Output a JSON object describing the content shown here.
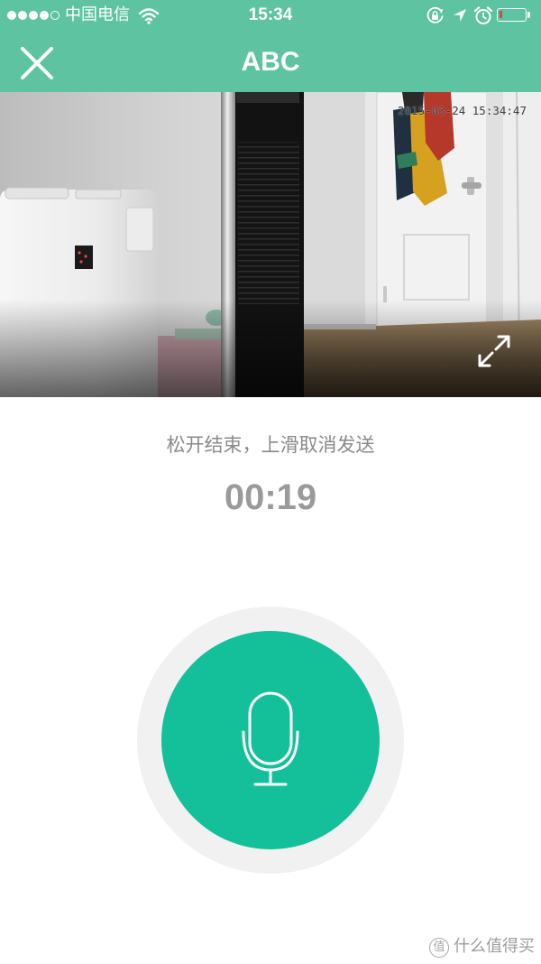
{
  "status_bar": {
    "signal_bars": 4,
    "signal_max": 5,
    "carrier": "中国电信",
    "time": "15:34",
    "battery_level": 0.1,
    "battery_color": "#e8403a",
    "icons": [
      "wifi-icon",
      "rotation-lock-icon",
      "location-icon",
      "alarm-icon",
      "battery-icon"
    ]
  },
  "header": {
    "title": "ABC",
    "close_icon": "close-icon",
    "background": "#5dc3a0"
  },
  "video": {
    "timestamp": "2015-03-24 15:34:47",
    "expand_icon": "fullscreen-icon"
  },
  "recording": {
    "hint": "松开结束，上滑取消发送",
    "timer": "00:19",
    "button_icon": "microphone-icon",
    "button_color": "#13c09a",
    "ring_color": "#f1f1f1"
  },
  "watermark": {
    "logo": "值",
    "text": "什么值得买"
  }
}
